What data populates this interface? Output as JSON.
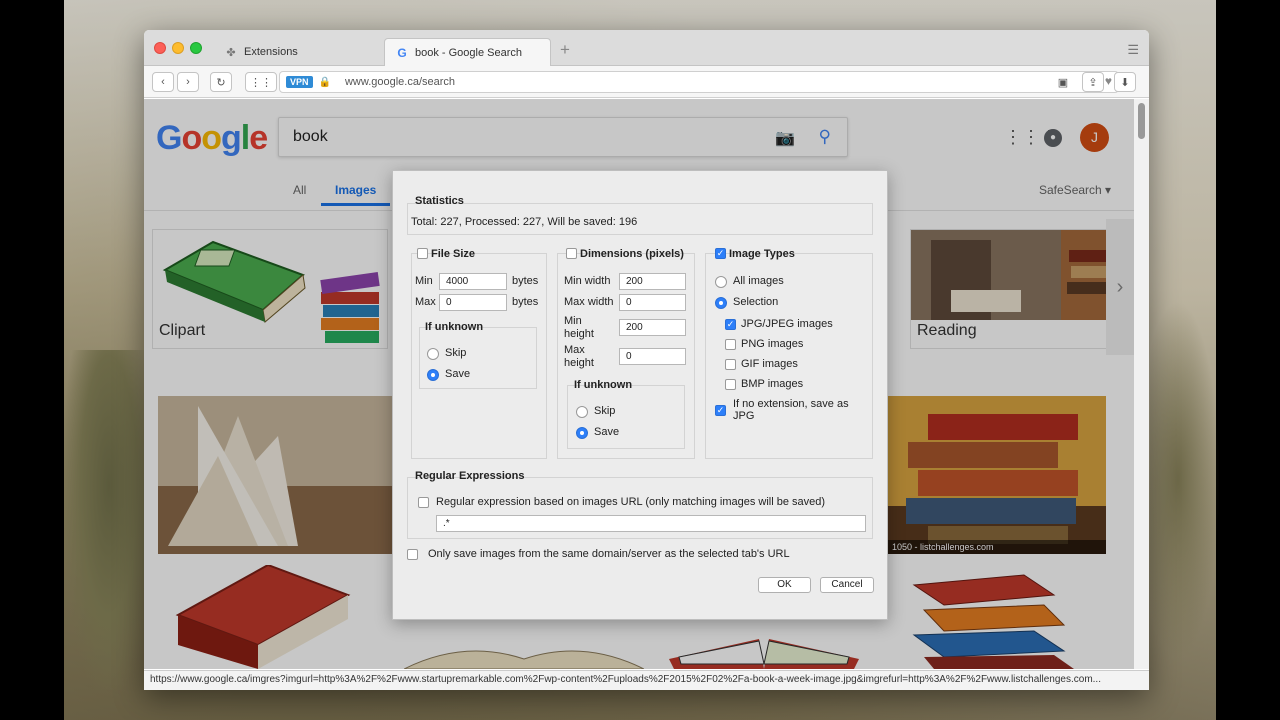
{
  "browser": {
    "tabs": [
      {
        "label": "Extensions",
        "icon": "puzzle-icon"
      },
      {
        "label": "book - Google Search",
        "icon": "google-g-icon"
      }
    ],
    "vpn_label": "VPN",
    "url": "www.google.ca/search"
  },
  "google": {
    "logo": [
      "G",
      "o",
      "o",
      "g",
      "l",
      "e"
    ],
    "query": "book",
    "avatar_letter": "J",
    "nav": {
      "all": "All",
      "images": "Images",
      "safesearch": "SafeSearch ▾"
    },
    "cards": {
      "clipart": "Clipart",
      "reading": "Reading"
    },
    "image_caption": "1050 - listchallenges.com"
  },
  "status_url": "https://www.google.ca/imgres?imgurl=http%3A%2F%2Fwww.startupremarkable.com%2Fwp-content%2Fuploads%2F2015%2F02%2Fa-book-a-week-image.jpg&imgrefurl=http%3A%2F%2Fwww.listchallenges.com...",
  "dialog": {
    "statistics": {
      "title": "Statistics",
      "text": "Total: 227, Processed: 227, Will be saved: 196"
    },
    "file_size": {
      "title": "File Size",
      "enabled": false,
      "min_label": "Min",
      "min_value": "4000",
      "max_label": "Max",
      "max_value": "0",
      "unit": "bytes",
      "unknown_title": "If unknown",
      "skip": "Skip",
      "save": "Save",
      "selected": "Save"
    },
    "dimensions": {
      "title": "Dimensions (pixels)",
      "enabled": false,
      "min_width_label": "Min width",
      "min_width": "200",
      "max_width_label": "Max width",
      "max_width": "0",
      "min_height_label_1": "Min",
      "min_height_label_2": "height",
      "min_height": "200",
      "max_height_label_1": "Max",
      "max_height_label_2": "height",
      "max_height": "0",
      "unknown_title": "If unknown",
      "skip": "Skip",
      "save": "Save",
      "selected": "Save"
    },
    "image_types": {
      "title": "Image Types",
      "enabled": true,
      "all_images": "All images",
      "selection": "Selection",
      "selected": "Selection",
      "jpg": "JPG/JPEG images",
      "jpg_checked": true,
      "png": "PNG images",
      "png_checked": false,
      "gif": "GIF images",
      "gif_checked": false,
      "bmp": "BMP images",
      "bmp_checked": false,
      "noext_1": "If no extension, save as",
      "noext_2": "JPG",
      "noext_checked": true
    },
    "regex": {
      "title": "Regular Expressions",
      "label": "Regular expression based on images URL (only matching images will be saved)",
      "value": ".*",
      "enabled": false
    },
    "same_domain": {
      "label": "Only save images from the same domain/server as the selected tab's URL",
      "checked": false
    },
    "ok": "OK",
    "cancel": "Cancel"
  },
  "colors": {
    "accent": "#2d7ff9",
    "link_blue": "#1a73e8",
    "avatar": "#d44d13"
  }
}
